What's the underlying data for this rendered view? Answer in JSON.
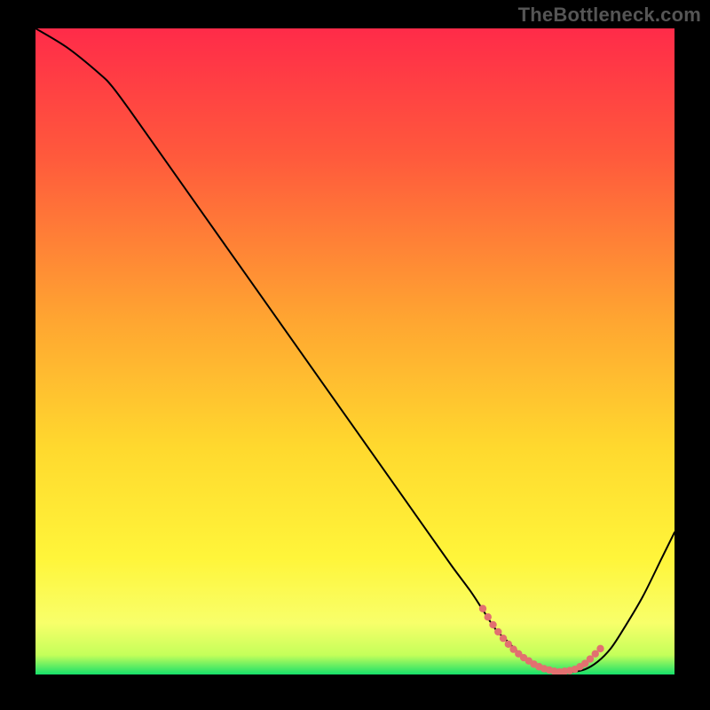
{
  "watermark": "TheBottleneck.com",
  "chart_data": {
    "type": "line",
    "title": "",
    "xlabel": "",
    "ylabel": "",
    "xlim": [
      0,
      100
    ],
    "ylim": [
      0,
      100
    ],
    "gradient_stops": [
      {
        "offset": 0.0,
        "color": "#ff2b49"
      },
      {
        "offset": 0.2,
        "color": "#ff5a3c"
      },
      {
        "offset": 0.45,
        "color": "#ffa531"
      },
      {
        "offset": 0.65,
        "color": "#ffd92e"
      },
      {
        "offset": 0.82,
        "color": "#fff53a"
      },
      {
        "offset": 0.92,
        "color": "#f8ff6a"
      },
      {
        "offset": 0.97,
        "color": "#c4ff5a"
      },
      {
        "offset": 1.0,
        "color": "#16e06a"
      }
    ],
    "series": [
      {
        "name": "bottleneck-curve",
        "color": "#000000",
        "x": [
          0,
          5,
          10,
          12,
          15,
          20,
          25,
          30,
          35,
          40,
          45,
          50,
          55,
          60,
          65,
          68,
          70,
          72,
          74,
          76,
          78,
          80,
          82,
          84,
          86,
          88,
          90,
          92,
          95,
          98,
          100
        ],
        "y": [
          100,
          97,
          93,
          91,
          87,
          80,
          73,
          66,
          59,
          52,
          45,
          38,
          31,
          24,
          17,
          13,
          10,
          7,
          5,
          3,
          1.6,
          0.8,
          0.4,
          0.4,
          0.8,
          2,
          4,
          7,
          12,
          18,
          22
        ]
      },
      {
        "name": "optimal-region-marker",
        "color": "#e27070",
        "style": "dotted",
        "x": [
          70.0,
          70.8,
          71.6,
          72.4,
          73.2,
          74.0,
          74.8,
          75.6,
          76.4,
          77.2,
          78.0,
          78.8,
          79.6,
          80.4,
          81.2,
          82.0,
          82.8,
          83.6,
          84.4,
          85.2,
          86.0,
          86.8,
          87.6,
          88.4
        ],
        "y": [
          10.2,
          8.9,
          7.7,
          6.6,
          5.6,
          4.7,
          3.9,
          3.2,
          2.6,
          2.1,
          1.6,
          1.2,
          0.9,
          0.7,
          0.5,
          0.4,
          0.5,
          0.6,
          0.8,
          1.2,
          1.7,
          2.4,
          3.2,
          4.0
        ]
      }
    ]
  }
}
